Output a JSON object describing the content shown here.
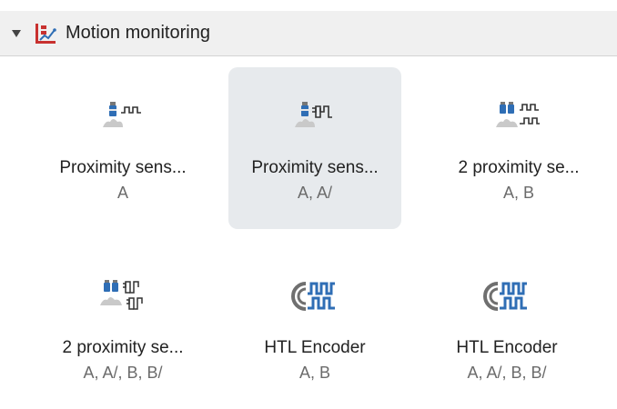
{
  "section": {
    "title": "Motion monitoring",
    "icon": "motion-monitoring-icon"
  },
  "tiles": [
    {
      "name": "Proximity sens...",
      "channels": "A",
      "icon": "proximity-sensor-single-icon"
    },
    {
      "name": "Proximity sens...",
      "channels": "A, A/",
      "icon": "proximity-sensor-complement-icon",
      "selected": true
    },
    {
      "name": "2 proximity se...",
      "channels": "A, B",
      "icon": "two-proximity-sensors-icon"
    },
    {
      "name": "2 proximity se...",
      "channels": "A, A/, B, B/",
      "icon": "two-proximity-sensors-complement-icon"
    },
    {
      "name": "HTL Encoder",
      "channels": "A, B",
      "icon": "htl-encoder-icon"
    },
    {
      "name": "HTL Encoder",
      "channels": "A, A/, B, B/",
      "icon": "htl-encoder-icon"
    }
  ],
  "colors": {
    "accent_blue": "#2f6eb5",
    "accent_red": "#c8312f",
    "icon_gray": "#6f6f6f",
    "selected_bg": "#e7eaed",
    "header_bg": "#f0f0f0"
  }
}
